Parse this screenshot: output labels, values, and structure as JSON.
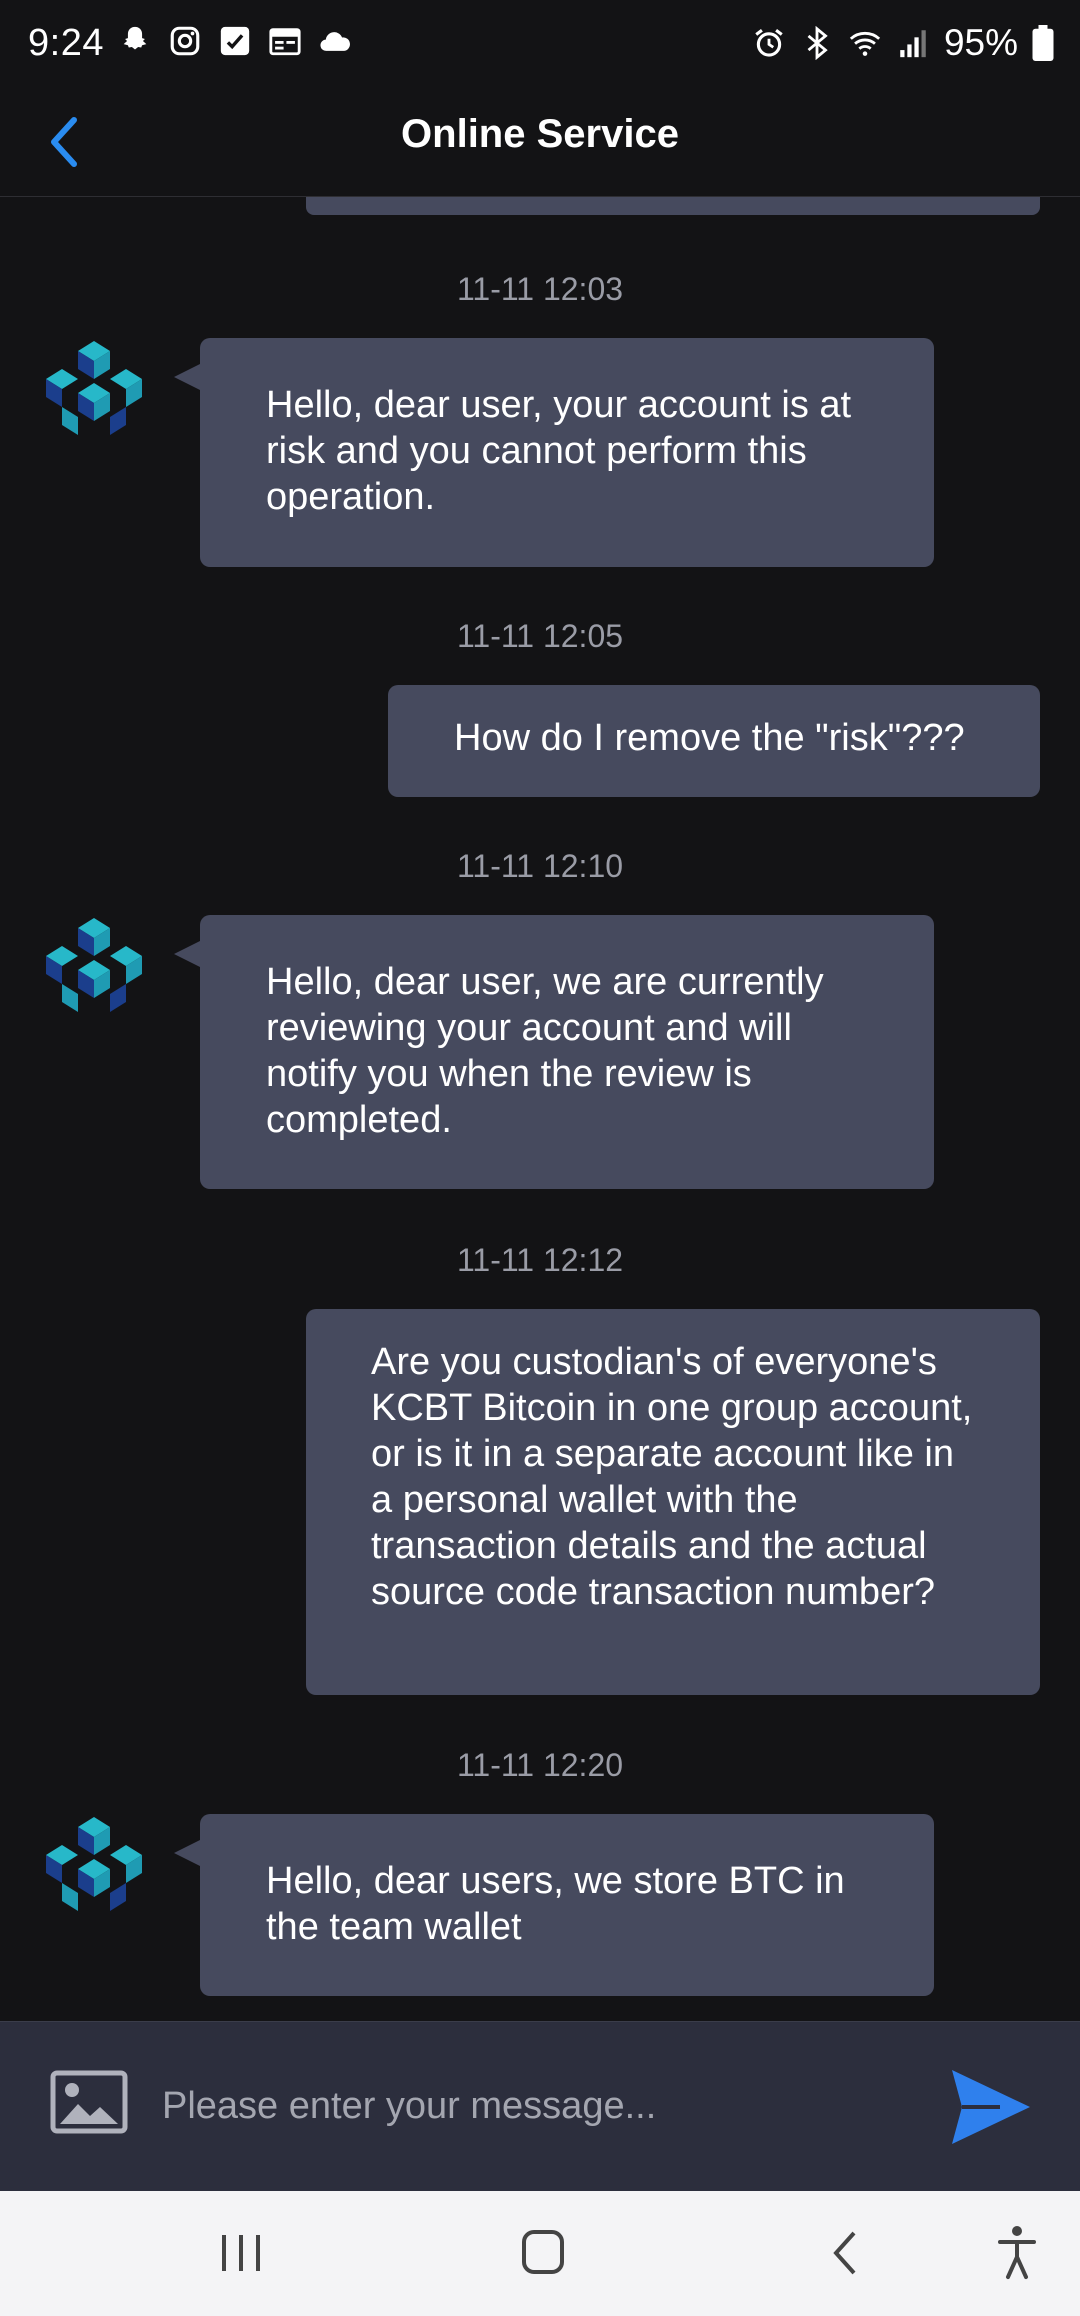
{
  "status_bar": {
    "time": "9:24",
    "battery": "95%",
    "left_icons": [
      "snapchat-icon",
      "instagram-icon",
      "call-filter-icon",
      "calendar-icon",
      "cloud-icon"
    ],
    "right_icons": [
      "alarm-icon",
      "bluetooth-icon",
      "wifi-icon",
      "signal-icon",
      "battery-icon"
    ]
  },
  "header": {
    "title": "Online Service",
    "back_icon": "chevron-left-icon",
    "accent_color": "#2a8cf0"
  },
  "messages": [
    {
      "timestamp": "11-11 12:03",
      "sender": "agent",
      "text": " Hello, dear user, your account is at risk and you cannot perform this operation."
    },
    {
      "timestamp": "11-11 12:05",
      "sender": "user",
      "text": "How do I remove the \"risk\"???"
    },
    {
      "timestamp": "11-11 12:10",
      "sender": "agent",
      "text": " Hello, dear user, we are currently reviewing your account and will notify you when the review is completed."
    },
    {
      "timestamp": "11-11 12:12",
      "sender": "user",
      "text": "Are you custodian's of everyone's KCBT Bitcoin in one group account, or is it in a separate account like in a personal wallet with the transaction details and the actual source code transaction number?"
    },
    {
      "timestamp": "11-11 12:20",
      "sender": "agent",
      "text": " Hello, dear users, we store BTC in the team wallet"
    }
  ],
  "composer": {
    "placeholder": "Please enter your message...",
    "image_icon": "image-icon",
    "send_icon": "send-icon",
    "send_color": "#2f80ed"
  },
  "nav_bar": {
    "buttons": [
      "recent-apps-icon",
      "home-icon",
      "back-icon",
      "accessibility-icon"
    ]
  }
}
